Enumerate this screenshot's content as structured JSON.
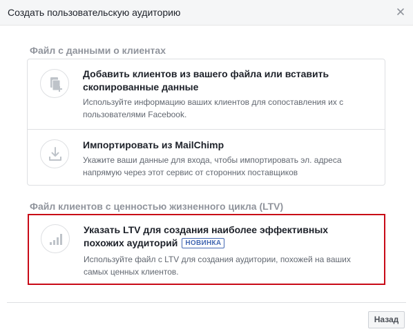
{
  "dialog": {
    "title": "Создать пользовательскую аудиторию",
    "close_icon": "close-icon"
  },
  "customer_file_section": {
    "title": "Файл с данными о клиентах",
    "options": [
      {
        "icon": "document-add-icon",
        "title": "Добавить клиентов из вашего файла или вставить скопированные данные",
        "description": "Используйте информацию ваших клиентов для сопоставления их с пользователями Facebook."
      },
      {
        "icon": "import-icon",
        "title": "Импортировать из MailChimp",
        "description": "Укажите ваши данные для входа, чтобы импортировать эл. адреса напрямую через этот сервис от сторонних поставщиков"
      }
    ]
  },
  "ltv_section": {
    "title": "Файл клиентов с ценностью жизненного цикла (LTV)",
    "option": {
      "icon": "bar-chart-icon",
      "title": "Указать LTV для создания наиболее эффективных похожих аудиторий",
      "badge": "НОВИНКА",
      "description": "Используйте файл с LTV для создания аудитории, похожей на ваших самых ценных клиентов."
    },
    "highlight_color": "#c80815"
  },
  "footer": {
    "back_label": "Назад"
  }
}
